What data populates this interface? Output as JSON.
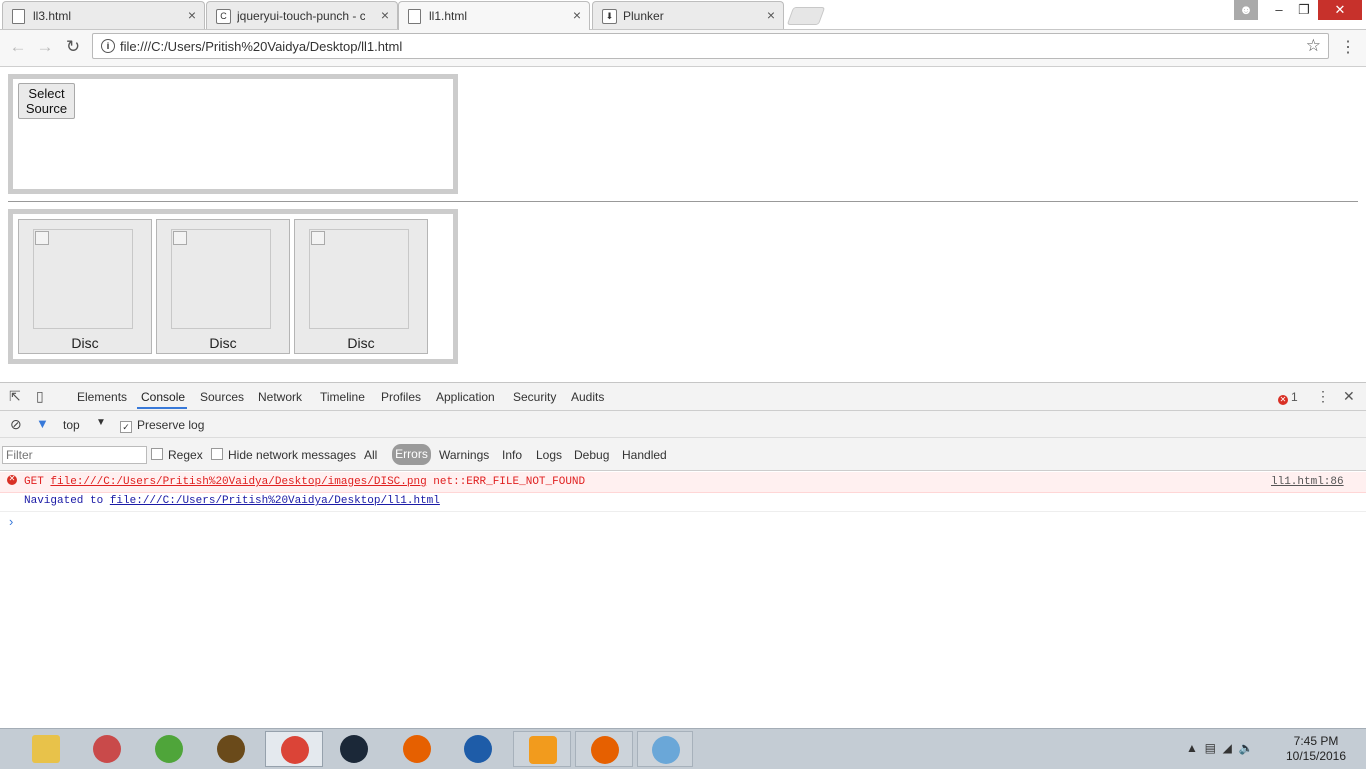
{
  "browser": {
    "tabs": [
      {
        "title": "ll3.html",
        "favicon": "page-icon"
      },
      {
        "title": "jqueryui-touch-punch - c",
        "favicon": "c-letter-icon"
      },
      {
        "title": "ll1.html",
        "favicon": "page-icon",
        "active": true
      },
      {
        "title": "Plunker",
        "favicon": "plunker-icon"
      }
    ],
    "close_glyph": "×",
    "address": "file:///C:/Users/Pritish%20Vaidya/Desktop/ll1.html",
    "address_icon": "i"
  },
  "page": {
    "select_source_label": "Select\nSource",
    "discs": [
      {
        "label": "Disc"
      },
      {
        "label": "Disc"
      },
      {
        "label": "Disc"
      }
    ]
  },
  "devtools": {
    "tabs": [
      "Elements",
      "Console",
      "Sources",
      "Network",
      "Timeline",
      "Profiles",
      "Application",
      "Security",
      "Audits"
    ],
    "active_tab": "Console",
    "error_count": "1",
    "context": "top",
    "preserve_log_label": "Preserve log",
    "filter_placeholder": "Filter",
    "regex_label": "Regex",
    "hide_network_label": "Hide network messages",
    "levels": [
      "All",
      "Errors",
      "Warnings",
      "Info",
      "Logs",
      "Debug",
      "Handled"
    ],
    "active_level": "Errors",
    "messages": {
      "error": {
        "method": "GET",
        "url": "file:///C:/Users/Pritish%20Vaidya/Desktop/images/DISC.png",
        "code": "net::ERR_FILE_NOT_FOUND",
        "source": "ll1.html:86"
      },
      "navigated": {
        "prefix": "Navigated to",
        "url": "file:///C:/Users/Pritish%20Vaidya/Desktop/ll1.html"
      }
    },
    "prompt_glyph": "›"
  },
  "taskbar": {
    "apps": [
      {
        "name": "file-explorer-icon",
        "color": "#e8c24a"
      },
      {
        "name": "rocket-app-icon",
        "color": "#c94a4a"
      },
      {
        "name": "utorrent-icon",
        "color": "#4fa53a"
      },
      {
        "name": "warcraft-icon",
        "color": "#6a4a1a"
      },
      {
        "name": "chrome-icon",
        "color": "#db4437"
      },
      {
        "name": "steam-icon",
        "color": "#1b2838"
      },
      {
        "name": "firefox-icon",
        "color": "#e66000"
      },
      {
        "name": "globe-app-icon",
        "color": "#1e5ca8"
      },
      {
        "name": "sublime-text-icon",
        "color": "#f29b1d"
      },
      {
        "name": "firefox-icon",
        "color": "#e66000"
      },
      {
        "name": "paint-icon",
        "color": "#6aa7d8"
      }
    ],
    "time": "7:45 PM",
    "date": "10/15/2016"
  }
}
